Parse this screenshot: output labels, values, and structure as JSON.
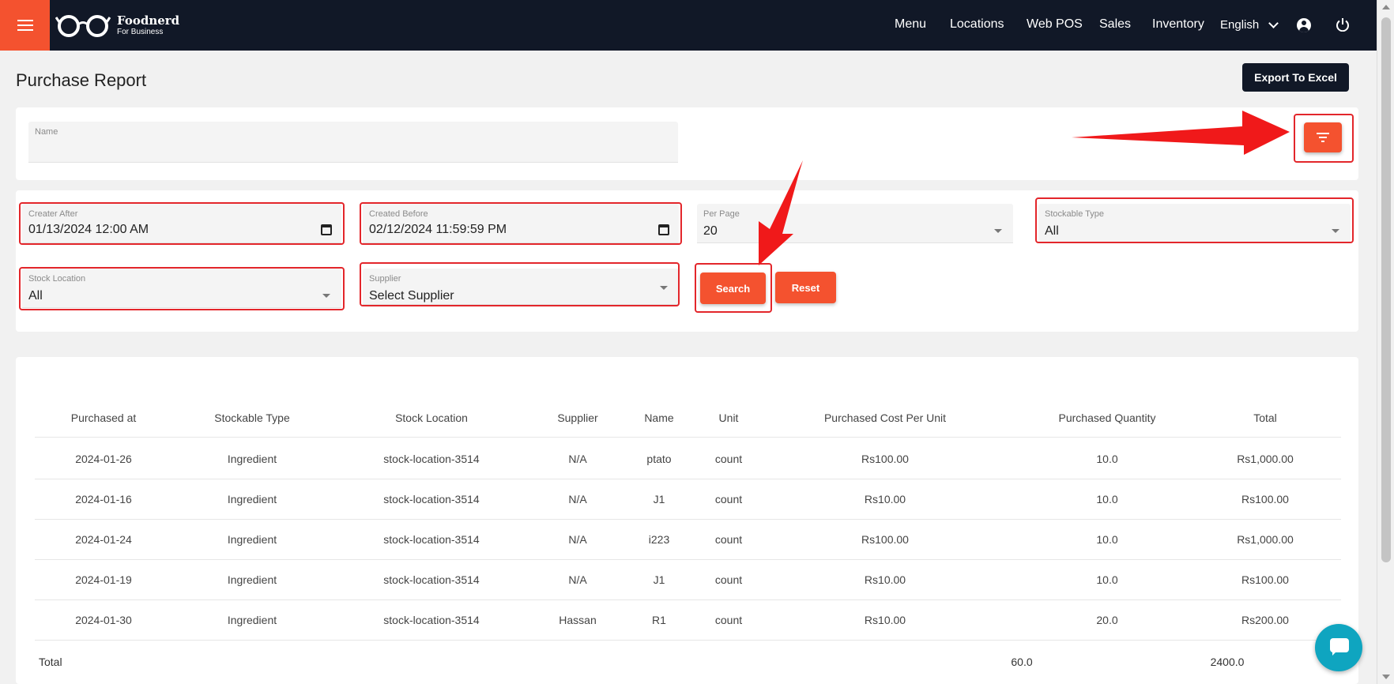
{
  "header": {
    "brand_name": "Foodnerd",
    "brand_sub": "For Business",
    "nav": [
      "Menu",
      "Locations",
      "Web POS",
      "Sales",
      "Inventory"
    ],
    "language": "English"
  },
  "page": {
    "title": "Purchase Report",
    "export_label": "Export To Excel"
  },
  "search": {
    "name_label": "Name",
    "name_value": ""
  },
  "filters": {
    "created_after_label": "Creater After",
    "created_after_value": "01/13/2024 12:00 AM",
    "created_before_label": "Created Before",
    "created_before_value": "02/12/2024 11:59:59 PM",
    "per_page_label": "Per Page",
    "per_page_value": "20",
    "stockable_type_label": "Stockable Type",
    "stockable_type_value": "All",
    "stock_location_label": "Stock Location",
    "stock_location_value": "All",
    "supplier_label": "Supplier",
    "supplier_value": "Select Supplier",
    "search_label": "Search",
    "reset_label": "Reset"
  },
  "table": {
    "columns": [
      "Purchased at",
      "Stockable Type",
      "Stock Location",
      "Supplier",
      "Name",
      "Unit",
      "Purchased Cost Per Unit",
      "Purchased Quantity",
      "Total"
    ],
    "rows": [
      [
        "2024-01-26",
        "Ingredient",
        "stock-location-3514",
        "N/A",
        "ptato",
        "count",
        "Rs100.00",
        "10.0",
        "Rs1,000.00"
      ],
      [
        "2024-01-16",
        "Ingredient",
        "stock-location-3514",
        "N/A",
        "J1",
        "count",
        "Rs10.00",
        "10.0",
        "Rs100.00"
      ],
      [
        "2024-01-24",
        "Ingredient",
        "stock-location-3514",
        "N/A",
        "i223",
        "count",
        "Rs100.00",
        "10.0",
        "Rs1,000.00"
      ],
      [
        "2024-01-19",
        "Ingredient",
        "stock-location-3514",
        "N/A",
        "J1",
        "count",
        "Rs10.00",
        "10.0",
        "Rs100.00"
      ],
      [
        "2024-01-30",
        "Ingredient",
        "stock-location-3514",
        "Hassan",
        "R1",
        "count",
        "Rs10.00",
        "20.0",
        "Rs200.00"
      ]
    ],
    "total_label": "Total",
    "total_quantity": "60.0",
    "total_amount": "2400.0"
  },
  "colors": {
    "accent": "#f4522f",
    "header_bg": "#111827",
    "annotation": "#e3262b",
    "chat": "#0fa5c0"
  }
}
